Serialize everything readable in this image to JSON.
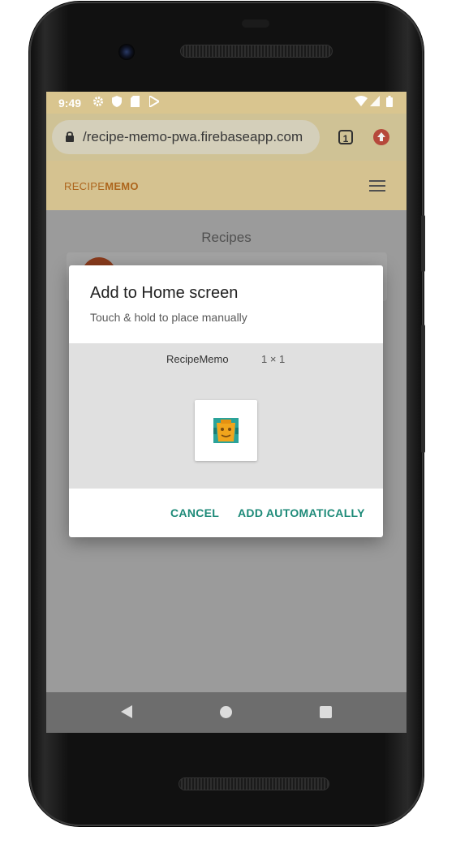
{
  "status_bar": {
    "time": "9:49",
    "left_icons": [
      "settings-icon",
      "shield-icon",
      "sd-card-icon",
      "play-store-icon"
    ],
    "right_icons": [
      "wifi-icon",
      "signal-icon",
      "battery-icon"
    ]
  },
  "browser": {
    "url": "/recipe-memo-pwa.firebaseapp.com",
    "tab_count": "1",
    "update_icon": "update-icon"
  },
  "app_header": {
    "brand_light": "RECIPE",
    "brand_bold": "MEMO",
    "menu_icon": "hamburger-menu-icon"
  },
  "page": {
    "title": "Recipes"
  },
  "dialog": {
    "title": "Add to Home screen",
    "subtitle": "Touch & hold to place manually",
    "widget_name": "RecipeMemo",
    "widget_size": "1 × 1",
    "cancel_label": "CANCEL",
    "add_label": "ADD AUTOMATICALLY"
  },
  "nav_bar": {
    "icons": [
      "back-icon",
      "home-icon",
      "recents-icon"
    ]
  },
  "colors": {
    "accent": "#1d8a78",
    "brand": "#b86c1e",
    "header": "#e3cf9a"
  }
}
